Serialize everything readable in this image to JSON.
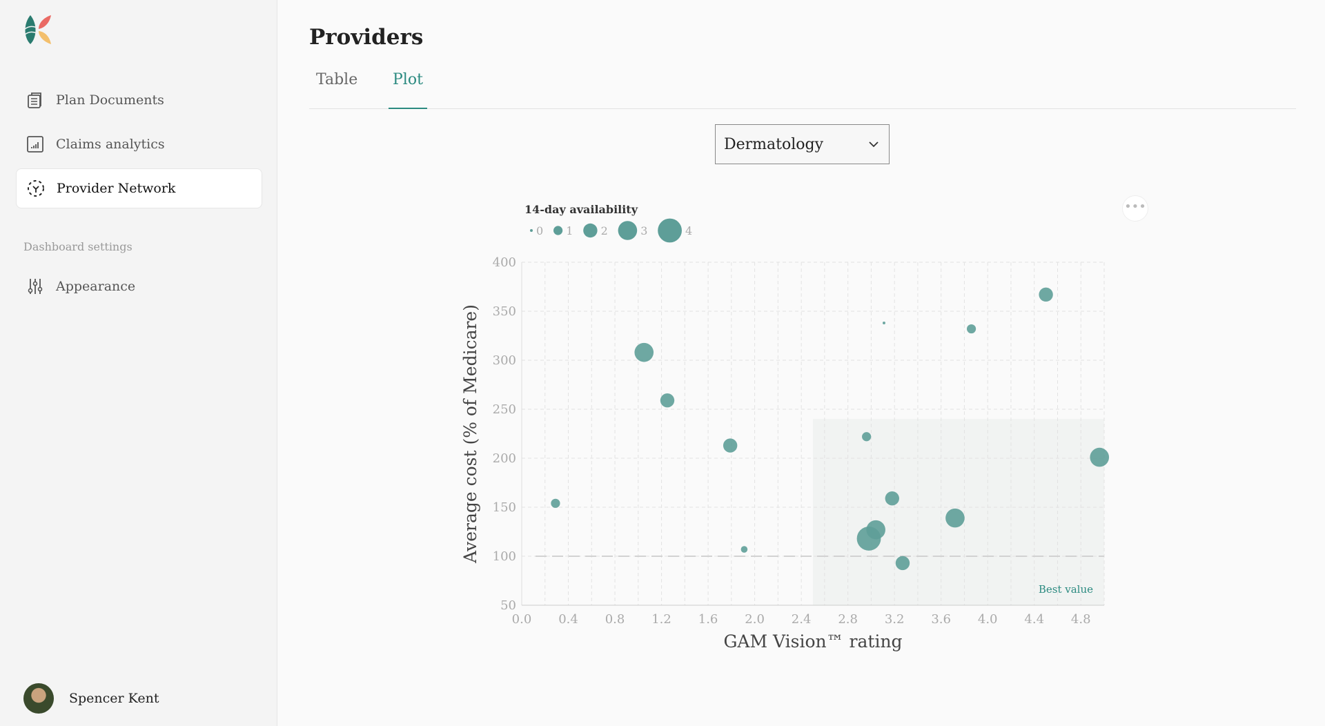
{
  "sidebar": {
    "items": [
      {
        "label": "Plan Documents",
        "icon": "clipboard-icon"
      },
      {
        "label": "Claims analytics",
        "icon": "bar-chart-icon"
      },
      {
        "label": "Provider Network",
        "icon": "network-icon",
        "active": true
      }
    ],
    "section_label": "Dashboard settings",
    "settings_items": [
      {
        "label": "Appearance",
        "icon": "sliders-icon"
      }
    ],
    "user": {
      "name": "Spencer Kent"
    }
  },
  "header": {
    "title": "Providers"
  },
  "tabs": [
    {
      "label": "Table"
    },
    {
      "label": "Plot",
      "active": true
    }
  ],
  "specialty_select": {
    "value": "Dermatology"
  },
  "colors": {
    "accent": "#2b8a80",
    "bubble": "#5e9e98",
    "best_value_region": "#f1f3f2"
  },
  "chart_data": {
    "type": "scatter",
    "xlabel": "GAM Vision™ rating",
    "ylabel": "Average cost (% of Medicare)",
    "xlim": [
      0,
      5
    ],
    "ylim": [
      50,
      400
    ],
    "xticks": [
      "0.0",
      "0.4",
      "0.8",
      "1.2",
      "1.6",
      "2.0",
      "2.4",
      "2.8",
      "3.2",
      "3.6",
      "4.0",
      "4.4",
      "4.8"
    ],
    "yticks": [
      "50",
      "100",
      "150",
      "200",
      "250",
      "300",
      "350",
      "400"
    ],
    "grid": true,
    "size_legend": {
      "title": "14-day availability",
      "values": [
        "0",
        "1",
        "2",
        "3",
        "4"
      ],
      "placement": "top-left"
    },
    "reference_line": {
      "y": 100
    },
    "annotation": {
      "label": "Best value",
      "region": {
        "x": [
          2.5,
          5
        ],
        "y": [
          50,
          240
        ]
      }
    },
    "points": [
      {
        "x": 0.29,
        "y": 154,
        "availability": 1
      },
      {
        "x": 1.05,
        "y": 308,
        "availability": 3
      },
      {
        "x": 1.25,
        "y": 259,
        "availability": 2
      },
      {
        "x": 1.79,
        "y": 213,
        "availability": 2
      },
      {
        "x": 1.91,
        "y": 107,
        "availability": 0.5
      },
      {
        "x": 3.11,
        "y": 338,
        "availability": 0
      },
      {
        "x": 3.86,
        "y": 332,
        "availability": 1
      },
      {
        "x": 4.5,
        "y": 367,
        "availability": 2
      },
      {
        "x": 2.96,
        "y": 222,
        "availability": 1
      },
      {
        "x": 4.96,
        "y": 201,
        "availability": 3
      },
      {
        "x": 3.18,
        "y": 159,
        "availability": 2
      },
      {
        "x": 3.72,
        "y": 139,
        "availability": 3
      },
      {
        "x": 3.04,
        "y": 127,
        "availability": 3
      },
      {
        "x": 2.98,
        "y": 118,
        "availability": 4
      },
      {
        "x": 3.27,
        "y": 93,
        "availability": 2
      }
    ]
  }
}
